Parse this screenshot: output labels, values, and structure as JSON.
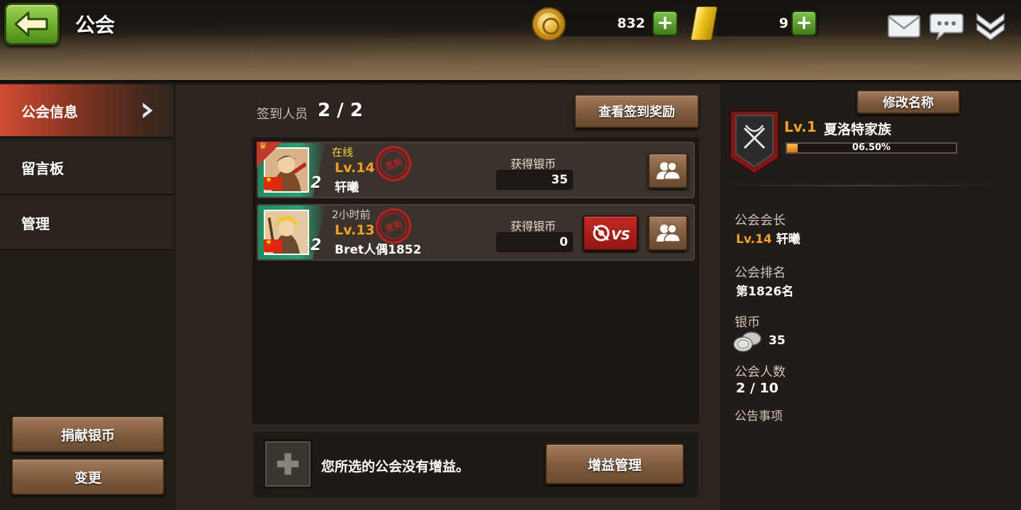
{
  "header": {
    "title": "公会",
    "coins": "832",
    "gold": "9"
  },
  "sidebar": {
    "items": [
      {
        "label": "公会信息"
      },
      {
        "label": "留言板"
      },
      {
        "label": "管理"
      }
    ],
    "donate_label": "捐献银币",
    "change_label": "变更"
  },
  "center": {
    "signin_label": "签到人员",
    "signin_count": "2 / 2",
    "view_reward_label": "查看签到奖励",
    "coin_label": "获得银币",
    "members": [
      {
        "status": "在线",
        "level": "Lv.14",
        "name": "轩曦",
        "rank": "2",
        "coins": "35",
        "stamp": "签到"
      },
      {
        "status": "2小时前",
        "level": "Lv.13",
        "name": "Bret人偶1852",
        "rank": "2",
        "coins": "0",
        "stamp": "签到"
      }
    ],
    "buff_text": "您所选的公会没有增益。",
    "buff_manage_label": "增益管理"
  },
  "right": {
    "rename_label": "修改名称",
    "guild_level": "Lv.1",
    "guild_name": "夏洛特家族",
    "xp_percent_text": "06.50%",
    "xp_fraction": 0.065,
    "leader_label": "公会会长",
    "leader_level": "Lv.14",
    "leader_name": "轩曦",
    "rank_label": "公会排名",
    "rank_value": "第1826名",
    "silver_label": "银币",
    "silver_value": "35",
    "members_label": "公会人数",
    "members_value": "2 / 10",
    "notice_label": "公告事项"
  },
  "colors": {
    "accent_orange": "#f0a226",
    "active_tab": "#d24c33",
    "online_green": "#2aa270"
  }
}
